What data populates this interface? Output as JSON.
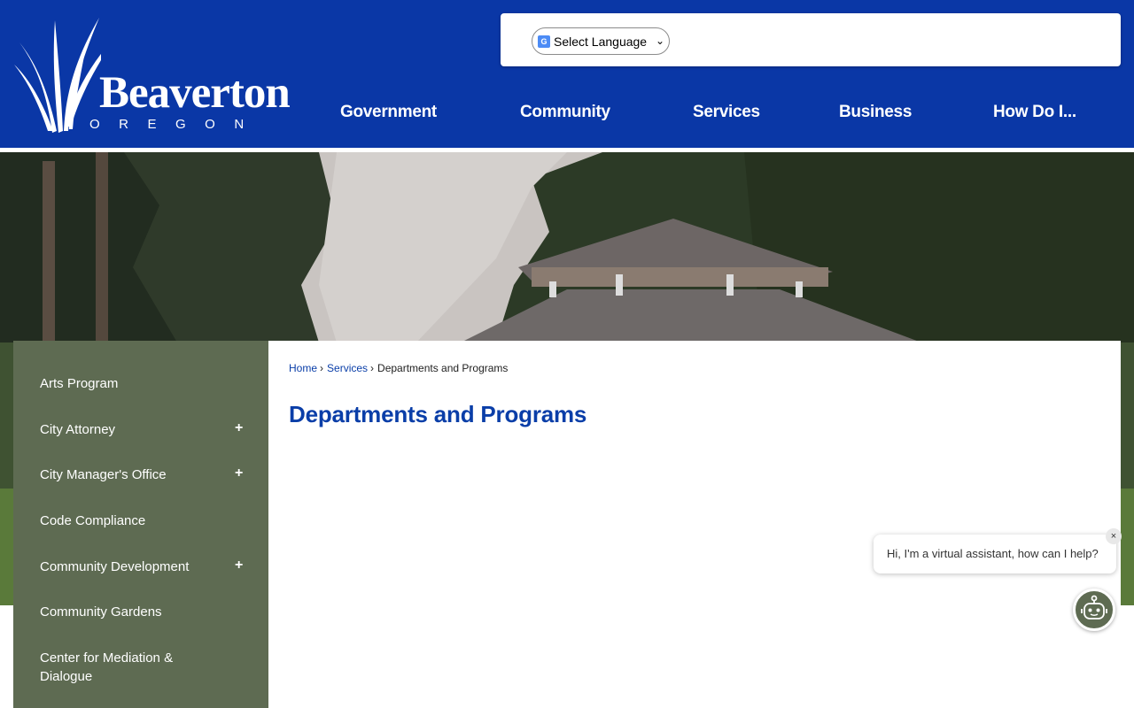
{
  "header": {
    "logo_name": "Beaverton",
    "logo_sub": "OREGON",
    "language_select": "Select Language",
    "nav": [
      {
        "label": "Government"
      },
      {
        "label": "Community"
      },
      {
        "label": "Services"
      },
      {
        "label": "Business"
      },
      {
        "label": "How Do I..."
      }
    ]
  },
  "sidebar": {
    "items": [
      {
        "label": "Arts Program",
        "expandable": false
      },
      {
        "label": "City Attorney",
        "expandable": true
      },
      {
        "label": "City Manager's Office",
        "expandable": true
      },
      {
        "label": "Code Compliance",
        "expandable": false
      },
      {
        "label": "Community Development",
        "expandable": true
      },
      {
        "label": "Community Gardens",
        "expandable": false
      },
      {
        "label": "Center for Mediation & Dialogue",
        "expandable": false
      }
    ],
    "expand_symbol": "+"
  },
  "breadcrumb": {
    "items": [
      "Home",
      "Services",
      "Departments and Programs"
    ],
    "separator": "›"
  },
  "main": {
    "title": "Departments and Programs"
  },
  "chat": {
    "message": "Hi, I'm a virtual assistant, how can I help?",
    "close_symbol": "×"
  },
  "colors": {
    "header_bg": "#0a37a6",
    "sidebar_bg": "#5e6b52",
    "link": "#0a3ea8"
  }
}
